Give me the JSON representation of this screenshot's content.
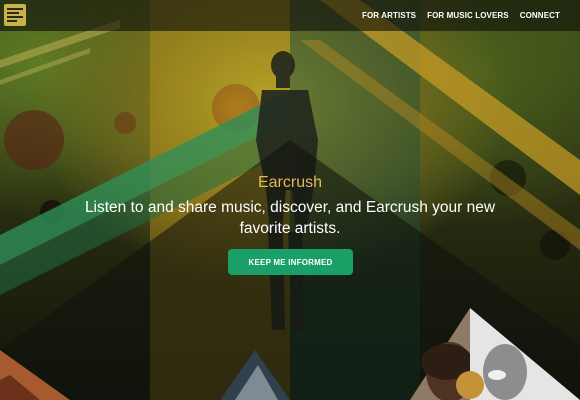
{
  "header": {
    "logo_icon": "stacked-lines-logo-icon",
    "nav": [
      {
        "label": "FOR ARTISTS"
      },
      {
        "label": "FOR MUSIC LOVERS"
      },
      {
        "label": "CONNECT"
      }
    ]
  },
  "hero": {
    "brand": "Earcrush",
    "tagline": "Listen to and share music, discover, and Earcrush your new favorite artists.",
    "cta_label": "KEEP ME INFORMED"
  },
  "colors": {
    "brand_gold": "#e3b85a",
    "cta_green": "#1aa066",
    "topbar": "#0e100a"
  }
}
